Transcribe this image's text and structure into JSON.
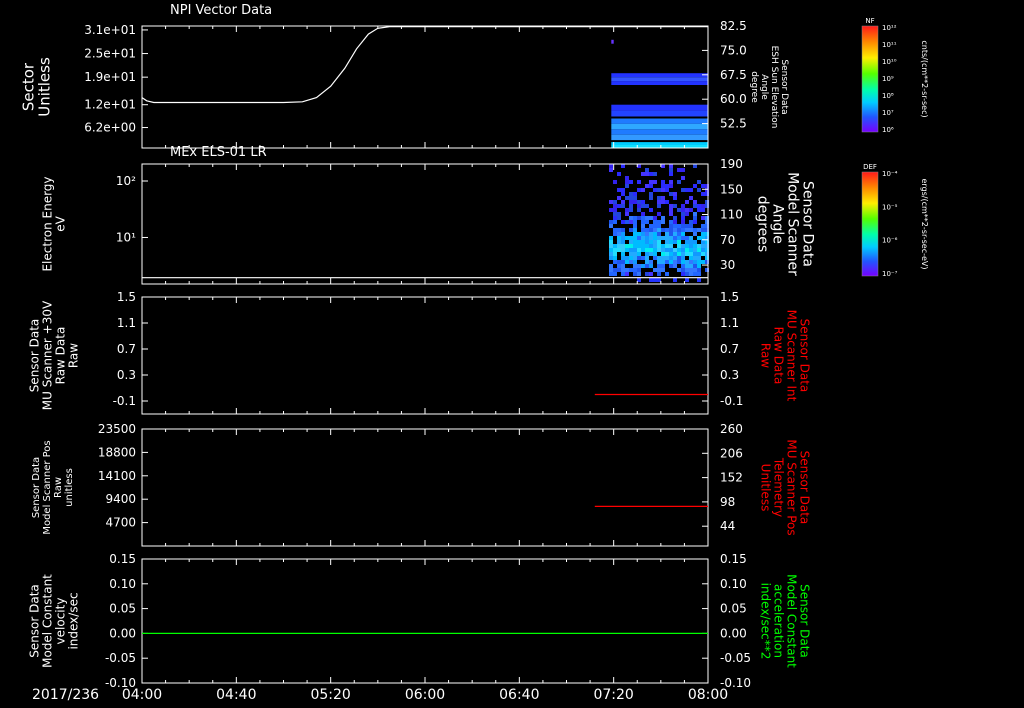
{
  "colors": {
    "background": "#000000",
    "axis": "#ffffff",
    "red": "#ff0000",
    "green": "#00ff00"
  },
  "x_axis": {
    "date_label": "2017/236",
    "ticks": [
      "04:00",
      "04:40",
      "05:20",
      "06:00",
      "06:40",
      "07:20",
      "08:00"
    ],
    "tick_minutes": [
      240,
      280,
      320,
      360,
      400,
      440,
      480
    ],
    "range_minutes": [
      240,
      480
    ],
    "time_label_format": "HH:MM"
  },
  "chart_data": [
    {
      "type": "spectrogram",
      "title": "NPI Vector Data",
      "left_axis": {
        "label": [
          "Sector",
          "Unitless"
        ],
        "ticks": [
          "3.1e+01",
          "2.5e+01",
          "1.9e+01",
          "1.2e+01",
          "6.2e+00"
        ],
        "tick_values": [
          31,
          25,
          19,
          12,
          6.2
        ],
        "range": [
          1,
          32
        ]
      },
      "right_axis": {
        "label": [
          "Sensor Data",
          "ESH Sun Elevation",
          "Angle",
          "degree"
        ],
        "ticks": [
          "82.5",
          "75.0",
          "67.5",
          "60.0",
          "52.5"
        ],
        "tick_values": [
          82.5,
          75.0,
          67.5,
          60.0,
          52.5
        ],
        "range": [
          45,
          82.5
        ]
      },
      "line_series": {
        "axis": "right",
        "color": "#ffffff",
        "time_min": [
          240,
          242,
          245,
          250,
          260,
          280,
          300,
          308,
          314,
          320,
          326,
          331,
          336,
          340,
          345,
          360,
          400,
          440,
          480
        ],
        "values": [
          60.5,
          59.5,
          59.0,
          59.0,
          59.0,
          59.0,
          59.0,
          59.2,
          60.5,
          64.0,
          69.5,
          75.5,
          80.0,
          81.8,
          82.3,
          82.3,
          82.3,
          82.3,
          82.3
        ]
      },
      "spectrogram_bands": [
        {
          "sector_range": [
            27.5,
            28.5
          ],
          "colors": [
            "#6633ff"
          ],
          "time_range": [
            439,
            440
          ]
        },
        {
          "sector_range": [
            17,
            20
          ],
          "colors": [
            "#2233ff",
            "#3355ff",
            "#2233ff"
          ],
          "time_range": [
            439,
            480
          ]
        },
        {
          "sector_range": [
            9,
            12
          ],
          "colors": [
            "#2233ff",
            "#2244ff"
          ],
          "time_range": [
            439,
            480
          ]
        },
        {
          "sector_range": [
            3,
            8.5
          ],
          "colors": [
            "#1f7bff",
            "#2fa8ff",
            "#1f7bff",
            "#3399ff"
          ],
          "time_range": [
            439,
            480
          ]
        },
        {
          "sector_range": [
            1,
            2.5
          ],
          "colors": [
            "#00ccff",
            "#10e0ff"
          ],
          "time_range": [
            439,
            480
          ]
        }
      ],
      "colorbar": {
        "label_top": "NF",
        "unit": "cnts/(cm**2-sr-sec)",
        "ticks": [
          "10¹²",
          "10¹¹",
          "10¹⁰",
          "10⁹",
          "10⁸",
          "10⁷",
          "10⁶"
        ]
      }
    },
    {
      "type": "spectrogram",
      "title": "MEx ELS-01 LR",
      "left_axis": {
        "label": [
          "Electron Energy",
          "eV"
        ],
        "ticks": [
          "10²",
          "10¹"
        ],
        "tick_values": [
          100,
          10
        ],
        "scale": "log",
        "range": [
          1.5,
          200
        ]
      },
      "right_axis": {
        "label": [
          "Sensor Data",
          "Model Scanner",
          "Angle",
          "degrees"
        ],
        "ticks": [
          "190",
          "150",
          "110",
          "70",
          "30"
        ],
        "tick_values": [
          190,
          150,
          110,
          70,
          30
        ],
        "range": [
          0,
          190
        ]
      },
      "line_series": {
        "axis": "right",
        "color": "#ffffff",
        "time_min": [
          240,
          480
        ],
        "values": [
          10,
          10
        ]
      },
      "noise_region": {
        "time_range": [
          438,
          480
        ],
        "energy_peak": 7
      },
      "colorbar": {
        "label_top": "DEF",
        "unit": "ergs/(cm**2-sr-sec-eV)",
        "ticks": [
          "10⁻⁴",
          "10⁻⁵",
          "10⁻⁶",
          "10⁻⁷"
        ]
      }
    },
    {
      "type": "line",
      "left_axis": {
        "label": [
          "Sensor Data",
          "MU Scanner +30V",
          "Raw Data",
          "Raw"
        ],
        "ticks": [
          "1.5",
          "1.1",
          "0.7",
          "0.3",
          "-0.1"
        ],
        "tick_values": [
          1.5,
          1.1,
          0.7,
          0.3,
          -0.1
        ],
        "range": [
          -0.3,
          1.5
        ]
      },
      "right_axis": {
        "label": [
          "Sensor Data",
          "MU Scanner Int",
          "Raw Data",
          "Raw"
        ],
        "ticks": [
          "1.5",
          "1.1",
          "0.7",
          "0.3",
          "-0.1"
        ],
        "tick_values": [
          1.5,
          1.1,
          0.7,
          0.3,
          -0.1
        ],
        "range": [
          -0.3,
          1.5
        ],
        "color": "#ff0000"
      },
      "series": [
        {
          "axis": "right",
          "color": "#ff0000",
          "time_min": [
            432,
            480
          ],
          "values": [
            0.0,
            0.0
          ]
        }
      ]
    },
    {
      "type": "line",
      "left_axis": {
        "label": [
          "Sensor Data",
          "Model Scanner Pos",
          "Raw",
          "unitless"
        ],
        "ticks": [
          "23500",
          "18800",
          "14100",
          "9400",
          "4700"
        ],
        "tick_values": [
          23500,
          18800,
          14100,
          9400,
          4700
        ],
        "range": [
          0,
          23500
        ]
      },
      "right_axis": {
        "label": [
          "Sensor Data",
          "MU Scanner Pos",
          "Telemetry",
          "Unitless"
        ],
        "ticks": [
          "260",
          "206",
          "152",
          "98",
          "44"
        ],
        "tick_values": [
          260,
          206,
          152,
          98,
          44
        ],
        "range": [
          0,
          260
        ],
        "color": "#ff0000"
      },
      "series": [
        {
          "axis": "right",
          "color": "#ff0000",
          "time_min": [
            432,
            480
          ],
          "values": [
            88,
            88
          ]
        }
      ]
    },
    {
      "type": "line",
      "left_axis": {
        "label": [
          "Sensor Data",
          "Model Constant",
          "velocity",
          "index/sec"
        ],
        "ticks": [
          "0.15",
          "0.10",
          "0.05",
          "0.00",
          "-0.05",
          "-0.10"
        ],
        "tick_values": [
          0.15,
          0.1,
          0.05,
          0.0,
          -0.05,
          -0.1
        ],
        "range": [
          -0.1,
          0.15
        ]
      },
      "right_axis": {
        "label": [
          "Sensor Data",
          "Model Constant",
          "acceleration",
          "index/sec**2"
        ],
        "ticks": [
          "0.15",
          "0.10",
          "0.05",
          "0.00",
          "-0.05",
          "-0.10"
        ],
        "tick_values": [
          0.15,
          0.1,
          0.05,
          0.0,
          -0.05,
          -0.1
        ],
        "range": [
          -0.1,
          0.15
        ],
        "color": "#00ff00"
      },
      "series": [
        {
          "axis": "right",
          "color": "#00ff00",
          "time_min": [
            240,
            480
          ],
          "values": [
            0.0,
            0.0
          ]
        }
      ]
    }
  ]
}
